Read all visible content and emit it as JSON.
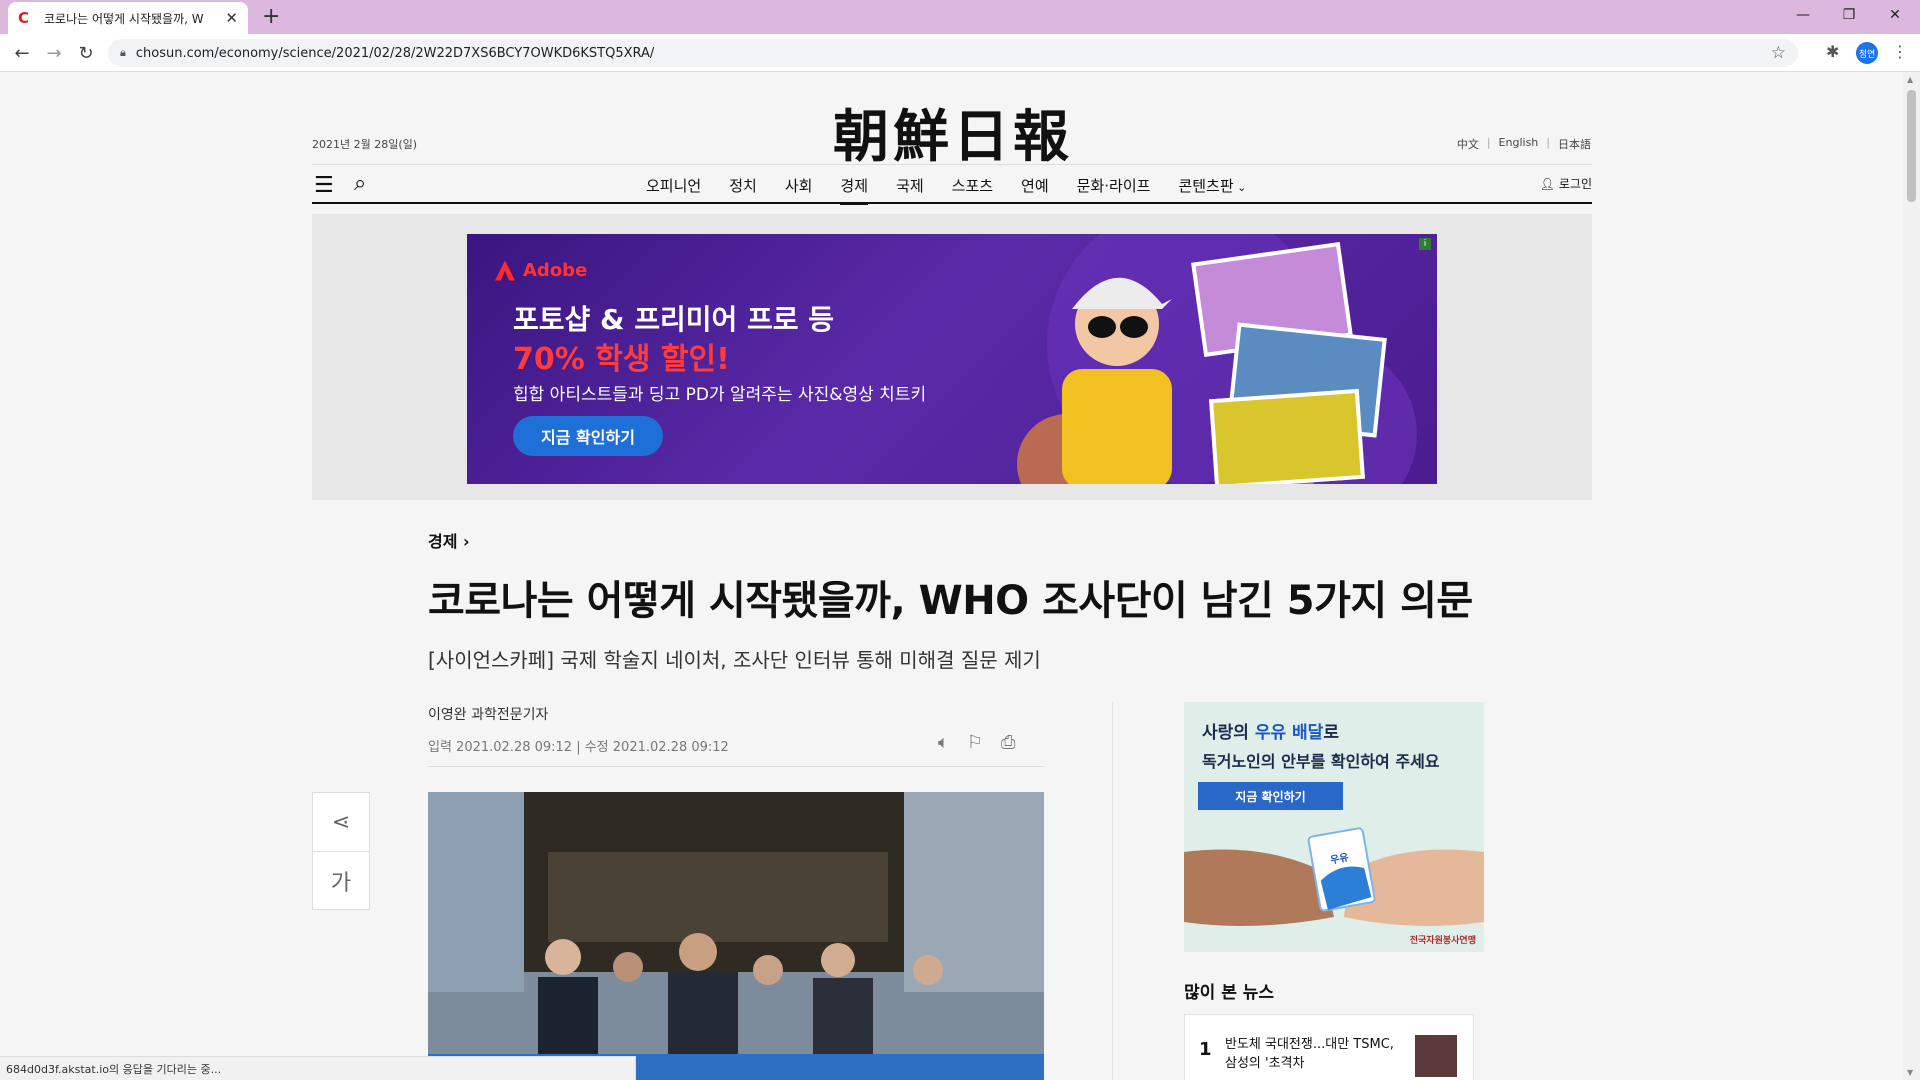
{
  "browser": {
    "tab_title": "코로나는 어떻게 시작됐을까, W",
    "url": "chosun.com/economy/science/2021/02/28/2W22D7XS6BCY7OWKD6KSTQ5XRA/",
    "profile_label": "정연",
    "status_text": "684d0d3f.akstat.io의 응답을 기다리는 중..."
  },
  "site": {
    "logo": "朝鮮日報",
    "date": "2021년 2월 28일(일)",
    "langs": [
      "中文",
      "English",
      "日本語"
    ],
    "nav": [
      "오피니언",
      "정치",
      "사회",
      "경제",
      "국제",
      "스포츠",
      "연예",
      "문화·라이프",
      "콘텐츠판"
    ],
    "active_nav": "경제",
    "login": "로그인"
  },
  "ad_banner": {
    "brand": "Adobe",
    "line1": "포토샵 & 프리미어 프로 등",
    "line2": "70% 학생 할인!",
    "line3": "힙합 아티스트들과 딩고 PD가 알려주는 사진&영상 치트키",
    "cta": "지금 확인하기"
  },
  "article": {
    "section": "경제",
    "headline": "코로나는 어떻게 시작됐을까, WHO 조사단이 남긴 5가지 의문",
    "subhead": "[사이언스카페] 국제 학술지 네이처, 조사단 인터뷰 통해 미해결 질문 제기",
    "byline": "이영완 과학전문기자",
    "dates": "입력 2021.02.28 09:12 | 수정 2021.02.28 09:12",
    "font_button": "가"
  },
  "rail_ad": {
    "line1_a": "사랑의 ",
    "line1_b": "우유 배달",
    "line1_c": "로",
    "line2": "독거노인의 안부를 확인하여 주세요",
    "cta": "지금 확인하기",
    "milk_label": "우유",
    "org": "전국자원봉사연맹"
  },
  "popular": {
    "title": "많이 본 뉴스",
    "items": [
      {
        "rank": "1",
        "title": "반도체 국대전쟁...대만 TSMC, 삼성의 '초격차"
      }
    ]
  }
}
